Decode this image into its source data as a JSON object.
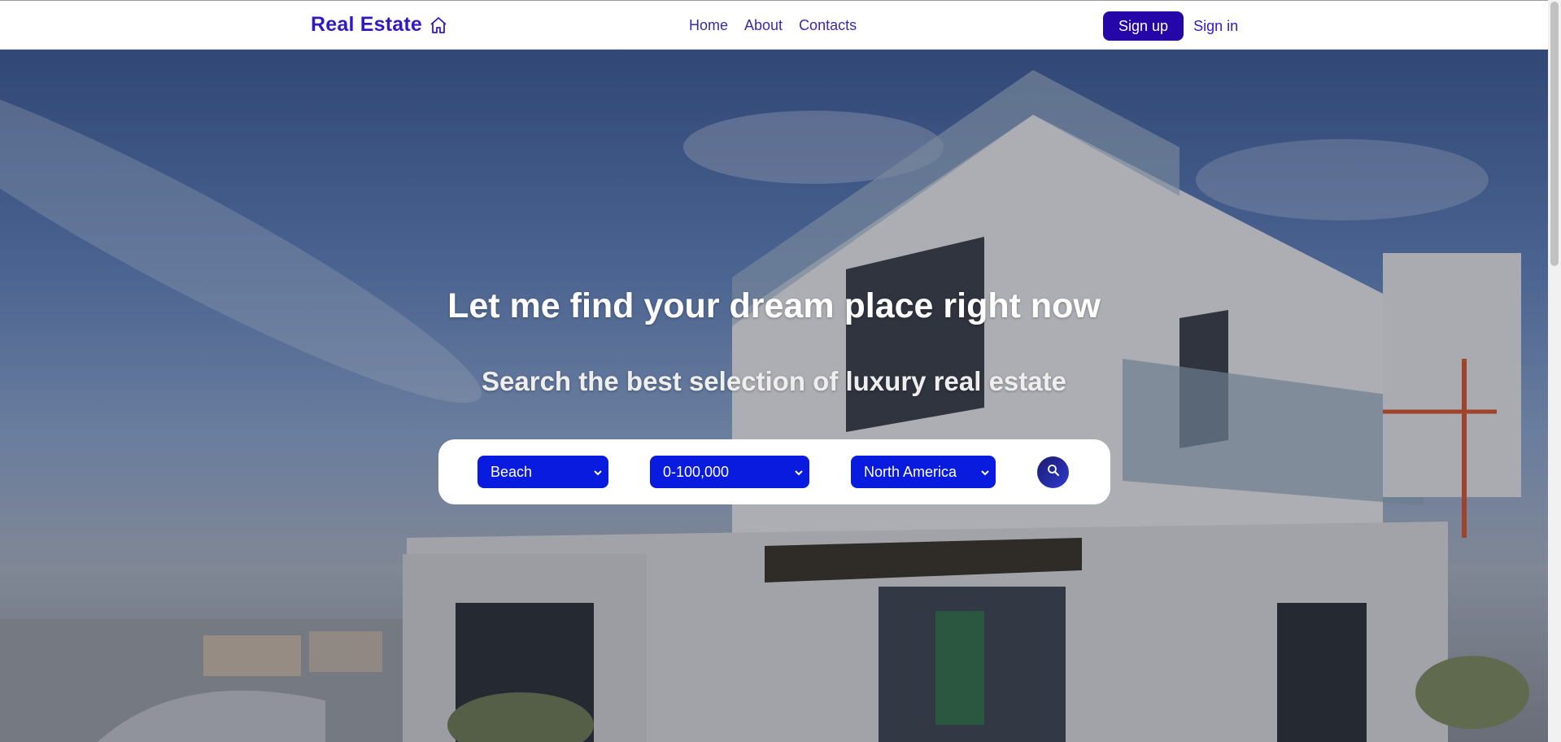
{
  "navbar": {
    "brand": "Real Estate",
    "brand_icon": "home-icon",
    "links": [
      "Home",
      "About",
      "Contacts"
    ],
    "signup_label": "Sign up",
    "signin_label": "Sign in"
  },
  "hero": {
    "title": "Let me find your dream place right now",
    "subtitle": "Search the best selection of luxury real estate",
    "background": "photo of a modern white luxury villa under a blue sky"
  },
  "search": {
    "type_selected": "Beach",
    "price_selected": "0-100,000",
    "region_selected": "North America",
    "search_icon": "search-icon"
  },
  "colors": {
    "brand": "#2f1ac4",
    "signup_bg": "#2506a8",
    "select_bg": "#0a1be0",
    "text_white": "#ffffff"
  }
}
